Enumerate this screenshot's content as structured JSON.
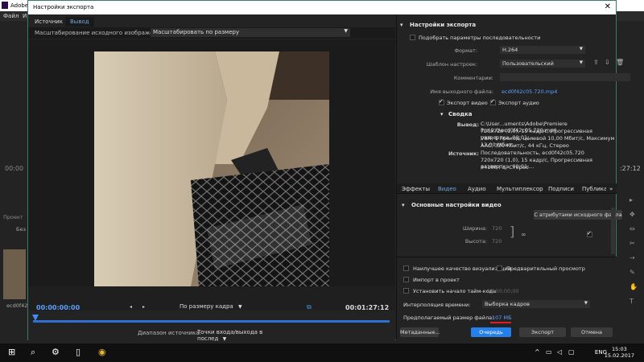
{
  "background_app": {
    "title_fragment": "Adobe",
    "menu": [
      "Файл",
      "И"
    ],
    "time_left": "00:00",
    "time_right": ":27:12",
    "project_label": "Проект",
    "file_label": "Без",
    "clip_label": "ecd0f42"
  },
  "dialog": {
    "title": "Настройки экспорта",
    "close": "✕"
  },
  "left": {
    "tabs": [
      "Источник",
      "Вывод"
    ],
    "scale_label": "Масштабирование исходного изображения:",
    "scale_value": "Масштабировать по размеру",
    "timecode_current": "00:00:00:00",
    "timecode_end": "00:01:27:12",
    "fit_value": "По размеру кадра",
    "range_label": "Диапазон источника:",
    "range_value": "Точки входа/выхода в послед"
  },
  "right": {
    "export_settings_header": "Настройки экспорта",
    "match_sequence": "Подобрать параметры последовательности",
    "format_label": "Формат:",
    "format_value": "H.264",
    "preset_label": "Шаблон настроек:",
    "preset_value": "Пользовательский",
    "comments_label": "Комментарии:",
    "output_name_label": "Имя выходного файла:",
    "output_name_value": "ecd0f42c05.720.mp4",
    "export_video": "Экспорт видео",
    "export_audio": "Экспорт аудио",
    "summary_header": "Сводка",
    "output_label": "Вывод:",
    "output_lines": [
      "C:\\User...uments\\Adobe\\Premiere Pro\\9.0\\ecd0f42c05.720.mp4",
      "720x720 (1,0), 15 кадр/с, Прогрессивная развертка, 00;01;...",
      "VBR, 1 проход, целевой 10,00 Мбит/с, Максимум 12,00 Мбит...",
      "AAC, 320 Кбит/с, 44 кГц, Стерео"
    ],
    "source_label": "Источник:",
    "source_lines": [
      "Последовательность, ecd0f42c05.720",
      "720x720 (1,0), 15 кадр/с, Прогрессивная развертка, 00;01;...",
      "44100 Гц, Стерео"
    ],
    "tabs": [
      "Эффекты",
      "Видео",
      "Аудио",
      "Мультиплексор",
      "Подписи",
      "Публикация"
    ],
    "video_header": "Основные настройки видео",
    "match_source_button": "С атрибутами исходного файла",
    "width_label": "Ширина:",
    "width_value": "720",
    "height_label": "Высота:",
    "height_value": "720",
    "max_quality": "Наилучшее качество визуализации",
    "use_previews": "Предварительный просмотр",
    "import_into_project": "Импорт в проект",
    "set_start_timecode": "Установить начало тайм-кода",
    "start_timecode_value": "00;00;00;00",
    "interp_label": "Интерполяция времени:",
    "interp_value": "Выборка кадров",
    "filesize_label": "Предполагаемый размер файла:",
    "filesize_value": "107 МБ",
    "metadata_button": "Метаданные...",
    "queue_button": "Очередь",
    "export_button": "Экспорт",
    "cancel_button": "Отмена"
  },
  "taskbar": {
    "lang": "ENG",
    "time": "15:03",
    "date": "15.02.2017"
  }
}
